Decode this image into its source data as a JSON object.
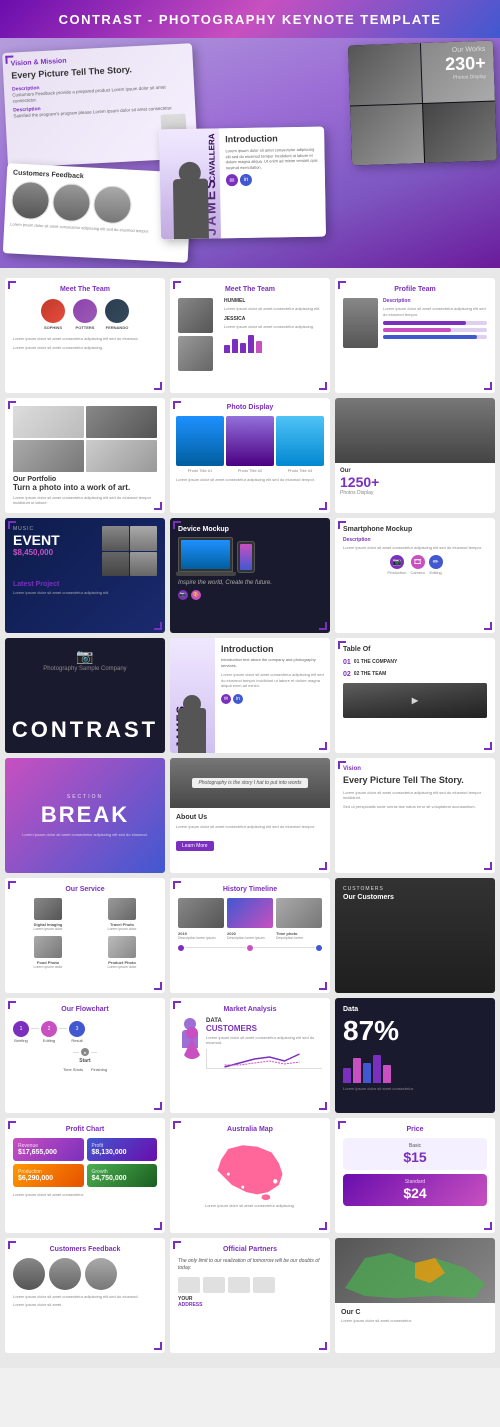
{
  "header": {
    "title": "CONTRAST - PHOTOGRAPHY KEYNOTE TEMPLATE",
    "bg_color": "#8b5cf6"
  },
  "hero": {
    "slides": {
      "vision": {
        "title": "Vision & Mission",
        "tagline": "Every Picture Tell The Story.",
        "desc1_label": "Description",
        "desc1_text": "Customers Feedback provide a prepared product Lorem ipsum dolor sit amet consectetur.",
        "desc2_label": "Description",
        "desc2_text": "Satisfied the program's program please Lorem ipsum dolor sit amet consectetur."
      },
      "our_works": {
        "title": "Our Works",
        "count": "230+",
        "subtext": "Photos Display"
      },
      "customers_feedback": {
        "title": "Customers Feedback"
      },
      "introduction": {
        "name": "JAMES CAVALLERA",
        "title": "Introduction"
      }
    }
  },
  "slides": [
    {
      "id": "meet-team-1",
      "title": "Meet The Team",
      "people": [
        "SOPHINS",
        "POTTERS",
        "FERNANDO"
      ]
    },
    {
      "id": "meet-team-2",
      "title": "Meet The Team",
      "people": [
        "HUNMEL",
        "JESSICA"
      ]
    },
    {
      "id": "profile-team",
      "title": "Profile Team",
      "label": "Description"
    },
    {
      "id": "our-portfolio",
      "title": "Our Portfolio",
      "tagline": "Turn a photo into a work of art."
    },
    {
      "id": "photo-display",
      "title": "Photo Display",
      "photos": [
        "Photo Title #1",
        "Photo Title #2",
        "Photo Title #3"
      ]
    },
    {
      "id": "our-slide",
      "title": "Our",
      "stat": "1250+",
      "stat_label": "Photos Display"
    },
    {
      "id": "latest-project",
      "title": "Latest Project",
      "event_label": "MUSIC",
      "event_title": "EVENT",
      "price": "$8,450,000"
    },
    {
      "id": "device-mockup",
      "title": "Device Mockup",
      "tagline": "Inspire the world, Create the future."
    },
    {
      "id": "smartphone-mockup",
      "title": "Smartphone Mockup",
      "label": "Description"
    },
    {
      "id": "contrast-title",
      "title": "CONTRAST",
      "subtitle": "Photography Sample Company"
    },
    {
      "id": "introduction-2",
      "name": "JAMES CAVALLERA",
      "title": "Introduction",
      "desc": "Introduction text about the company and photography services."
    },
    {
      "id": "table-of-contents",
      "title": "Table Of",
      "items": [
        "01 THE COMPANY",
        "02 THE TEAM"
      ]
    },
    {
      "id": "section-break",
      "label": "SECTION",
      "title": "BREAK"
    },
    {
      "id": "about-us",
      "title": "About Us",
      "tagline": "Photography is the story I hat to put into words"
    },
    {
      "id": "vision-2",
      "title": "Vision",
      "tagline": "Every Picture Tell The Story."
    },
    {
      "id": "our-service",
      "title": "Our Service",
      "services": [
        "Digital Imaging",
        "Travel Photo",
        "Food Photo",
        "Product Photo"
      ]
    },
    {
      "id": "history-timeline",
      "title": "History Timeline"
    },
    {
      "id": "our-customers",
      "title": "Our Customers",
      "label": "CUSTOMERS"
    },
    {
      "id": "our-flowchart",
      "title": "Our Flowchart",
      "steps": [
        "Briefing",
        "Editing",
        "Result",
        "Start",
        "Time Shots",
        "Finishing"
      ]
    },
    {
      "id": "market-analysis",
      "title": "Market Analysis",
      "data_label": "DATA",
      "customers_label": "CUSTOMERS"
    },
    {
      "id": "data-slide",
      "title": "Data",
      "percent": "87%"
    },
    {
      "id": "profit-chart",
      "title": "Profit Chart",
      "values": [
        "$17,655,000",
        "$8,130,000",
        "$6,290,000",
        "$4,750,000"
      ]
    },
    {
      "id": "australia-map",
      "title": "Australia Map"
    },
    {
      "id": "price-slide",
      "title": "Price",
      "plans": [
        {
          "name": "Basic",
          "price": "$15"
        },
        {
          "name": "Standard",
          "price": "$24"
        }
      ]
    },
    {
      "id": "customers-feedback",
      "title": "Customers Feedback"
    },
    {
      "id": "official-partners",
      "title": "Official Partners",
      "tagline": "The only limit to our realization of tomorrow will be our doubts of today."
    },
    {
      "id": "our-c",
      "title": "Our C"
    }
  ],
  "colors": {
    "primary_purple": "#7b2fbe",
    "accent_pink": "#c850c0",
    "dark_bg": "#1a1a2e",
    "light_purple": "#9c6fd6",
    "gradient_start": "#4158d0",
    "gradient_end": "#c850c0"
  }
}
